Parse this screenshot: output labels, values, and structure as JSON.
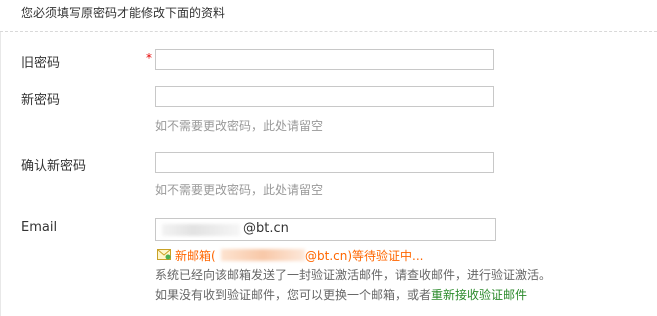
{
  "notice": "您必须填写原密码才能修改下面的资料",
  "fields": {
    "old_password": {
      "label": "旧密码",
      "required_mark": "*",
      "value": ""
    },
    "new_password": {
      "label": "新密码",
      "value": "",
      "hint": "如不需要更改密码，此处请留空"
    },
    "confirm_password": {
      "label": "确认新密码",
      "value": "",
      "hint": "如不需要更改密码，此处请留空"
    },
    "email": {
      "label": "Email",
      "visible_suffix": "@bt.cn",
      "pending_prefix": "新邮箱(",
      "pending_suffix": "@bt.cn)等待验证中...",
      "info_line1": "系统已经向该邮箱发送了一封验证激活邮件，请查收邮件，进行验证激活。",
      "info_line2_prefix": "如果没有收到验证邮件，您可以更换一个邮箱，或者",
      "resend_link": "重新接收验证邮件"
    }
  },
  "colors": {
    "required": "#e60000",
    "pending": "#ff6600",
    "link": "#2b8a2b",
    "hint": "#999999"
  },
  "icons": {
    "pending_mail": "envelope-icon"
  }
}
